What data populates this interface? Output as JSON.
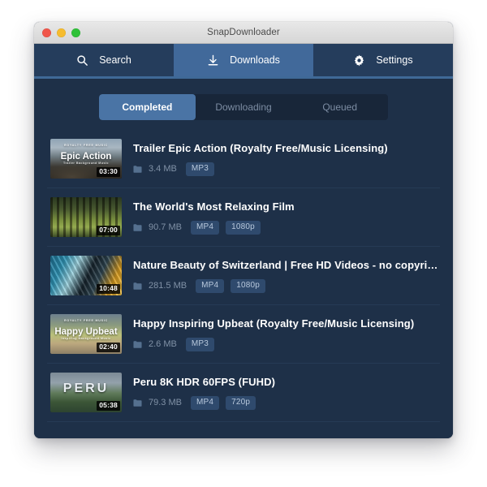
{
  "window": {
    "title": "SnapDownloader",
    "traffic_lights": [
      "close-button",
      "minimize-button",
      "zoom-button"
    ]
  },
  "nav": {
    "tabs": [
      {
        "label": "Search",
        "icon": "search-icon",
        "active": false
      },
      {
        "label": "Downloads",
        "icon": "download-icon",
        "active": true
      },
      {
        "label": "Settings",
        "icon": "gear-icon",
        "active": false
      }
    ]
  },
  "filters": {
    "tabs": [
      {
        "label": "Completed",
        "active": true
      },
      {
        "label": "Downloading",
        "active": false
      },
      {
        "label": "Queued",
        "active": false
      }
    ]
  },
  "downloads": [
    {
      "title": "Trailer Epic Action (Royalty Free/Music Licensing)",
      "size": "3.4 MB",
      "chips": [
        "MP3"
      ],
      "duration": "03:30",
      "thumb_caption": "Epic Action",
      "thumb_top_text": "ROYALTY FREE MUSIC",
      "thumb_sub_text": "Trailer Background Music",
      "thumb_style": "art-epic",
      "caption_style": "big"
    },
    {
      "title": "The World's Most Relaxing Film",
      "size": "90.7 MB",
      "chips": [
        "MP4",
        "1080p"
      ],
      "duration": "07:00",
      "thumb_caption": "",
      "thumb_top_text": "",
      "thumb_sub_text": "",
      "thumb_style": "art-forest",
      "caption_style": "big"
    },
    {
      "title": "Nature Beauty of Switzerland | Free HD Videos - no copyright",
      "size": "281.5 MB",
      "chips": [
        "MP4",
        "1080p"
      ],
      "duration": "10:48",
      "thumb_caption": "",
      "thumb_top_text": "",
      "thumb_sub_text": "",
      "thumb_style": "art-swiss",
      "caption_style": "big"
    },
    {
      "title": "Happy Inspiring Upbeat (Royalty Free/Music Licensing)",
      "size": "2.6 MB",
      "chips": [
        "MP3"
      ],
      "duration": "02:40",
      "thumb_caption": "Happy Upbeat",
      "thumb_top_text": "ROYALTY FREE MUSIC",
      "thumb_sub_text": "Inspiring Background Music",
      "thumb_style": "art-happy",
      "caption_style": "big"
    },
    {
      "title": "Peru 8K HDR 60FPS (FUHD)",
      "size": "79.3 MB",
      "chips": [
        "MP4",
        "720p"
      ],
      "duration": "05:38",
      "thumb_caption": "PERU",
      "thumb_top_text": "",
      "thumb_sub_text": "",
      "thumb_style": "art-peru",
      "caption_style": "huge"
    }
  ],
  "colors": {
    "window_bg": "#1e3048",
    "nav_bg": "#253d5c",
    "nav_active": "#41699a",
    "nav_underline": "#3f6997",
    "segment_bg": "#182639",
    "segment_active": "#4a74a5",
    "chip_bg": "#2f4a6d",
    "text_primary": "#ffffff",
    "text_muted": "#8091a6",
    "divider": "#2c4360"
  }
}
